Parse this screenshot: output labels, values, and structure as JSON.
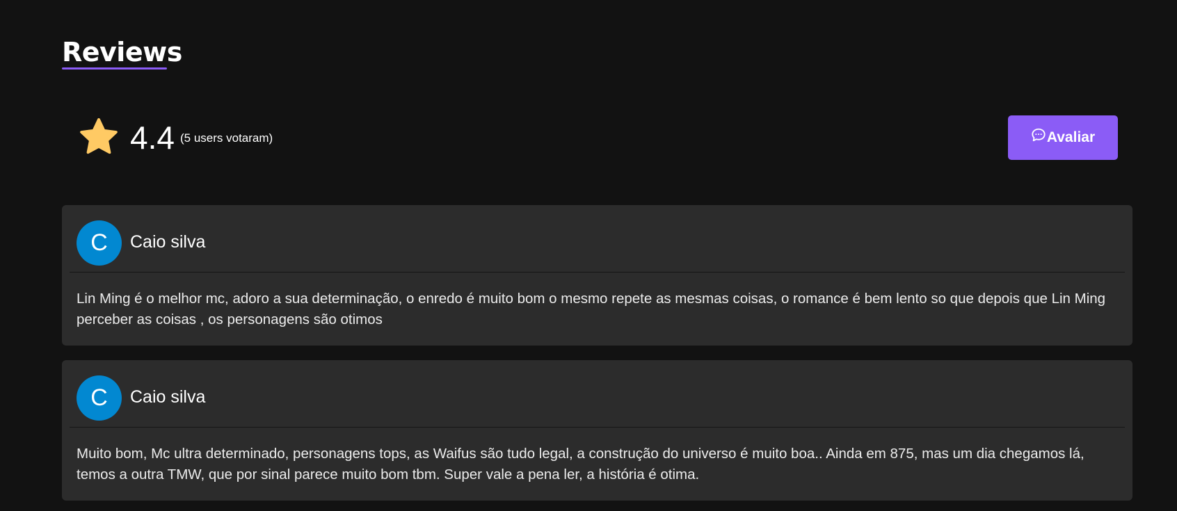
{
  "section": {
    "title": "Reviews"
  },
  "rating": {
    "value": "4.4",
    "count_text": "(5 users votaram)",
    "star_icon": "star-icon",
    "star_color": "#ffca64"
  },
  "rate_button": {
    "label": "Avaliar",
    "icon": "chat-bubble-icon",
    "color": "#8b5cf6"
  },
  "reviews": [
    {
      "avatar_letter": "C",
      "avatar_color": "#0288d1",
      "name": "Caio silva",
      "text": "Lin Ming é o melhor mc, adoro a sua determinação, o enredo é muito bom o mesmo repete as mesmas coisas, o romance é bem lento so que depois que Lin Ming perceber as coisas , os personagens são otimos"
    },
    {
      "avatar_letter": "C",
      "avatar_color": "#0288d1",
      "name": "Caio silva",
      "text": "Muito bom, Mc ultra determinado, personagens tops, as Waifus são tudo legal, a construção do universo é muito boa.. Ainda em 875, mas um dia chegamos lá, temos a outra TMW, que por sinal parece muito bom tbm. Super vale a pena ler, a história é otima."
    }
  ]
}
